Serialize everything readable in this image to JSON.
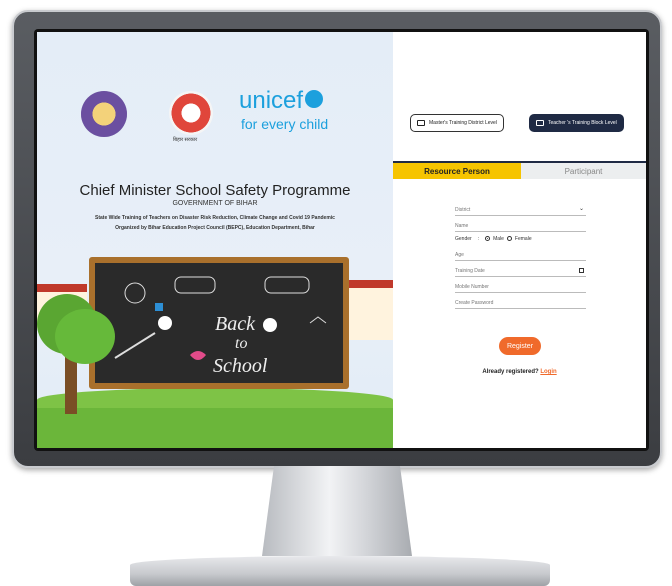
{
  "left_panel": {
    "seal2_caption": "बिहार सरकार",
    "unicef_text": "unicef",
    "tagline": "for every child",
    "title": "Chief Minister School Safety Programme",
    "government": "GOVERNMENT OF BIHAR",
    "subtitle1": "State Wide Training of Teachers on Disaster Risk Reduction, Climate Change and Covid 19 Pandemic",
    "subtitle2": "Organized by Bihar Education Project Council (BEPC), Education Department, Bihar",
    "board_line1": "Back",
    "board_line2": "to",
    "board_line3": "School"
  },
  "level_buttons": {
    "master": "Master's Training District Level",
    "teacher": "Teacher 's Training Block Level"
  },
  "tabs": {
    "resource": "Resource Person",
    "participant": "Participant"
  },
  "form": {
    "district_placeholder": "District",
    "name_placeholder": "Name",
    "gender_label": "Gender",
    "gender_sep": ":",
    "male": "Male",
    "female": "Female",
    "age_placeholder": "Age",
    "training_date_placeholder": "Training Date",
    "mobile_placeholder": "Mobile Number",
    "password_placeholder": "Create Password",
    "register_label": "Register",
    "already_text": "Already registered?",
    "login_link": "Login"
  },
  "colors": {
    "accent_orange": "#f06a2b",
    "tab_yellow": "#f6c400",
    "unicef_blue": "#1ca0dd",
    "navy": "#1f2a44"
  }
}
